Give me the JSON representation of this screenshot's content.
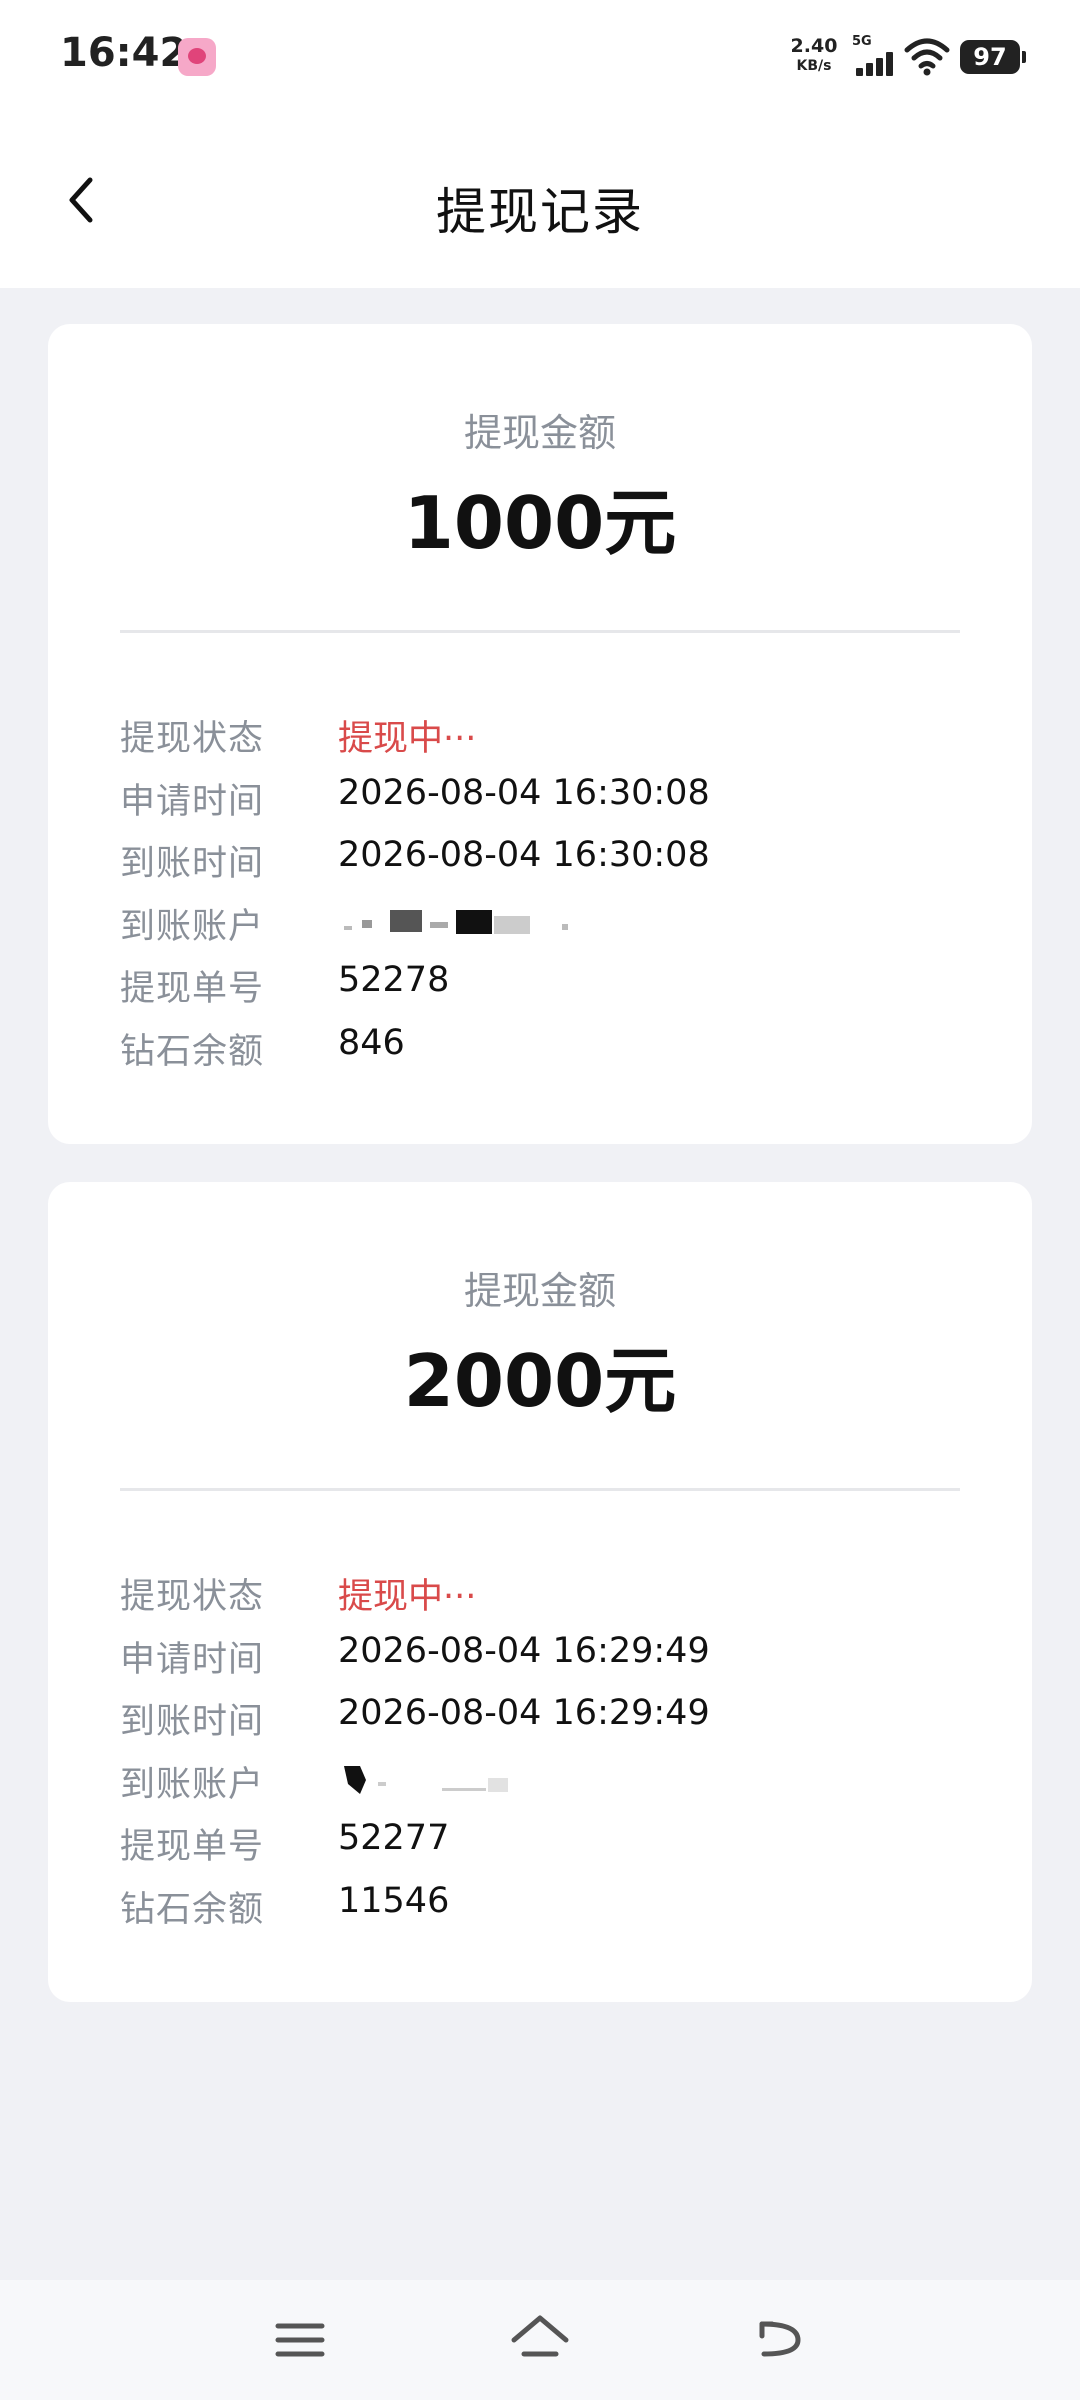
{
  "status_bar": {
    "time": "16:42",
    "net_speed": "2.40",
    "net_unit": "KB/s",
    "network": "5G",
    "battery": "97"
  },
  "header": {
    "title": "提现记录",
    "back_icon": "chevron-left-icon"
  },
  "records": [
    {
      "amount_label": "提现金额",
      "amount": "1000元",
      "details": [
        {
          "label": "提现状态",
          "value": "提现中···"
        },
        {
          "label": "申请时间",
          "value": "2026-08-04 16:30:08"
        },
        {
          "label": "到账时间",
          "value": "2026-08-04 16:30:08"
        },
        {
          "label": "到账账户",
          "value": ""
        },
        {
          "label": "提现单号",
          "value": "52278"
        },
        {
          "label": "钻石余额",
          "value": "846"
        }
      ]
    },
    {
      "amount_label": "提现金额",
      "amount": "2000元",
      "details": [
        {
          "label": "提现状态",
          "value": "提现中···"
        },
        {
          "label": "申请时间",
          "value": "2026-08-04 16:29:49"
        },
        {
          "label": "到账时间",
          "value": "2026-08-04 16:29:49"
        },
        {
          "label": "到账账户",
          "value": ""
        },
        {
          "label": "提现单号",
          "value": "52277"
        },
        {
          "label": "钻石余额",
          "value": "11546"
        }
      ]
    }
  ],
  "colors": {
    "status_pending": "#d94a4a",
    "label_gray": "#8a9099",
    "page_bg": "#f0f1f5"
  },
  "nav_bar": {
    "icons": [
      "menu-icon",
      "home-icon",
      "back-icon"
    ]
  }
}
